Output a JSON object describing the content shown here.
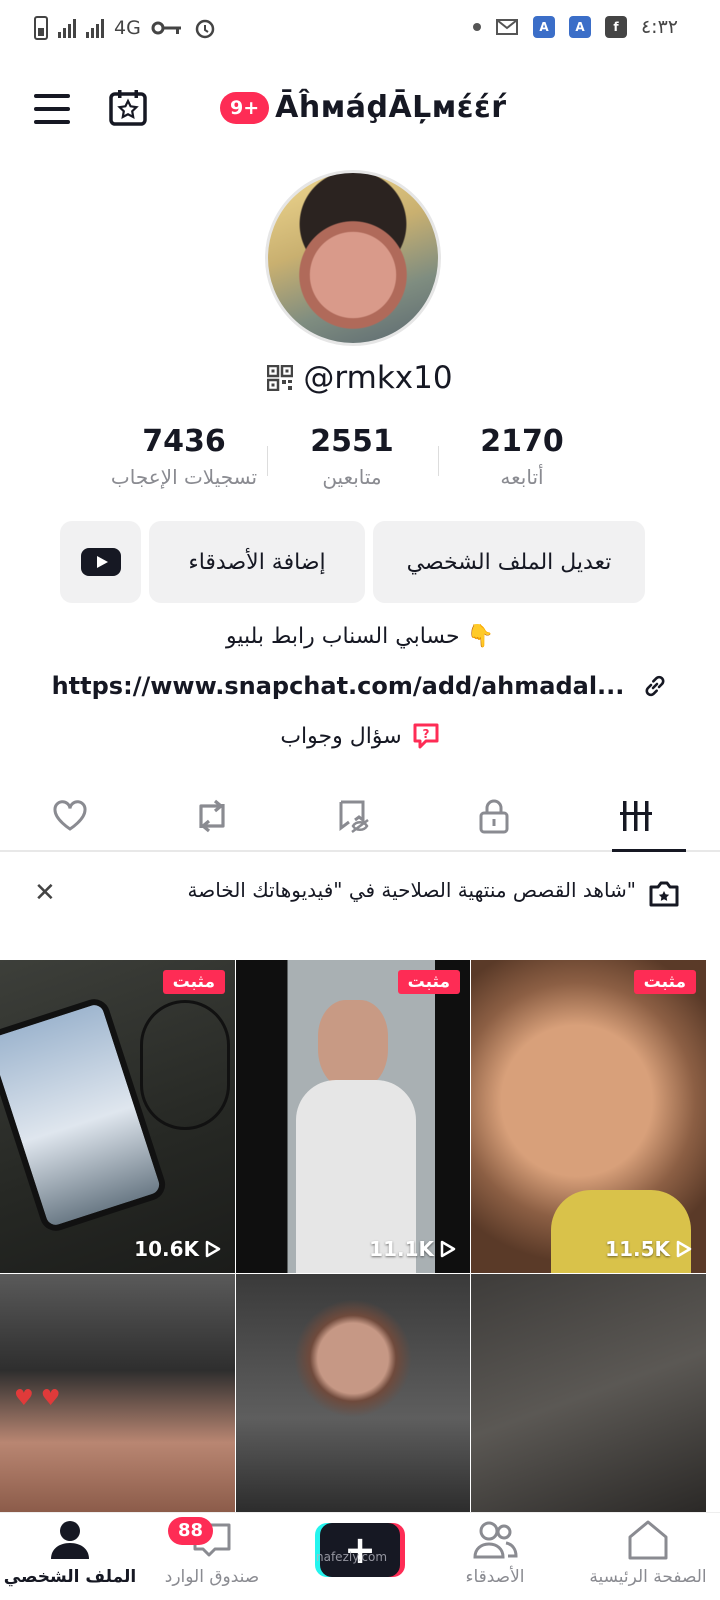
{
  "status_bar": {
    "network": "4G",
    "time": "٤:٣٢"
  },
  "header": {
    "notification_count": "9+",
    "display_name": "ĀĥмáḑĀĻмέέŕ"
  },
  "profile": {
    "handle": "@rmkx10",
    "stats": [
      {
        "value": "7436",
        "label": "تسجيلات الإعجاب"
      },
      {
        "value": "2551",
        "label": "متابعين"
      },
      {
        "value": "2170",
        "label": "أتابعه"
      }
    ],
    "buttons": {
      "edit_profile": "تعديل الملف الشخصي",
      "add_friends": "إضافة الأصدقاء"
    },
    "bio": "حسابي السناب رابط بلبيو 👇",
    "link": "https://www.snapchat.com/add/ahmadal...",
    "qa": "سؤال وجواب"
  },
  "notice": {
    "text": "شاهد القصص منتهية الصلاحية في \"فيديوهاتك الخاصة\""
  },
  "videos": [
    {
      "pinned_label": "مثبت",
      "views": "10.6K"
    },
    {
      "pinned_label": "مثبت",
      "views": "11.1K"
    },
    {
      "pinned_label": "مثبت",
      "views": "11.5K"
    },
    {
      "pinned_label": "",
      "views": ""
    },
    {
      "pinned_label": "",
      "views": ""
    },
    {
      "pinned_label": "",
      "views": ""
    }
  ],
  "bottom_nav": {
    "home": "الصفحة الرئيسية",
    "friends": "الأصدقاء",
    "inbox": "صندوق الوارد",
    "inbox_badge": "88",
    "profile": "الملف الشخصي",
    "watermark": "nafezly.com"
  },
  "colors": {
    "accent": "#fe2c55",
    "text": "#161823",
    "muted": "#8a8b91",
    "button_bg": "#f1f1f2"
  }
}
